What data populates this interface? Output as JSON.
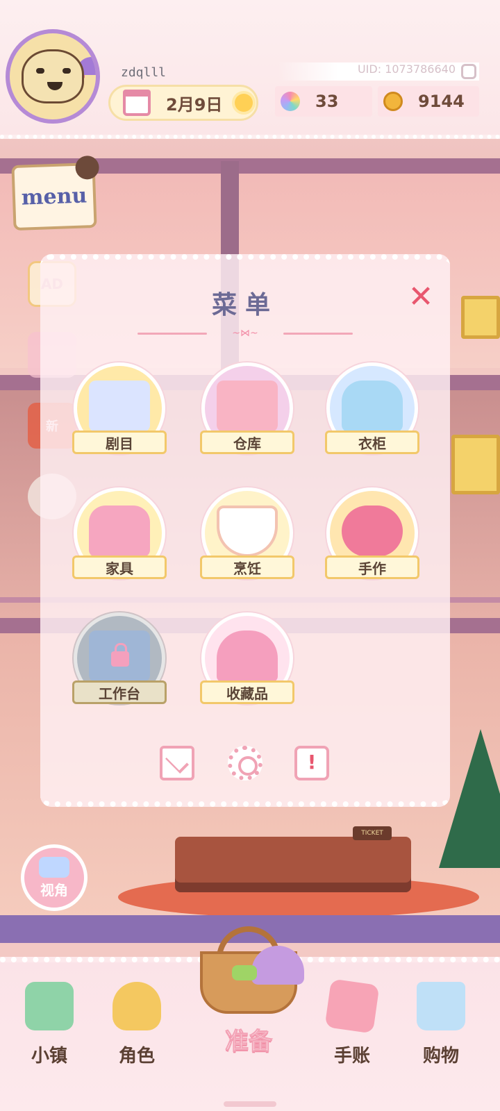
{
  "hud": {
    "username": "zdqlll",
    "uid": "UID: 1073786640",
    "date": "2月9日",
    "gems": "33",
    "coins": "9144"
  },
  "side": {
    "menu_label": "menu",
    "ad_label": "AD",
    "new_label": "新",
    "view_label": "视角"
  },
  "scene": {
    "ticket_label": "TICKET"
  },
  "panel": {
    "title": "菜单",
    "items": [
      {
        "label": "剧目",
        "icon": "script-book-icon",
        "color": "#ffe9a8"
      },
      {
        "label": "仓库",
        "icon": "storage-box-icon",
        "color": "#f4d0ea"
      },
      {
        "label": "衣柜",
        "icon": "dress-icon",
        "color": "#d6e8ff"
      },
      {
        "label": "家具",
        "icon": "sofa-icon",
        "color": "#fff0b8"
      },
      {
        "label": "烹饪",
        "icon": "cooking-bowl-icon",
        "color": "#fff3c9"
      },
      {
        "label": "手作",
        "icon": "scissors-icon",
        "color": "#ffe6b0"
      },
      {
        "label": "工作台",
        "icon": "workbench-locked-icon",
        "color": "#b9d0e8",
        "locked": true
      },
      {
        "label": "收藏品",
        "icon": "carousel-icon",
        "color": "#ffe3ee"
      }
    ]
  },
  "nav": {
    "town": "小镇",
    "character": "角色",
    "prepare": "准备",
    "journal": "手账",
    "shop": "购物"
  },
  "colors": {
    "accent_pink": "#e8566e",
    "panel_title": "#6c6a95",
    "ribbon_gold": "#f2c86a"
  }
}
